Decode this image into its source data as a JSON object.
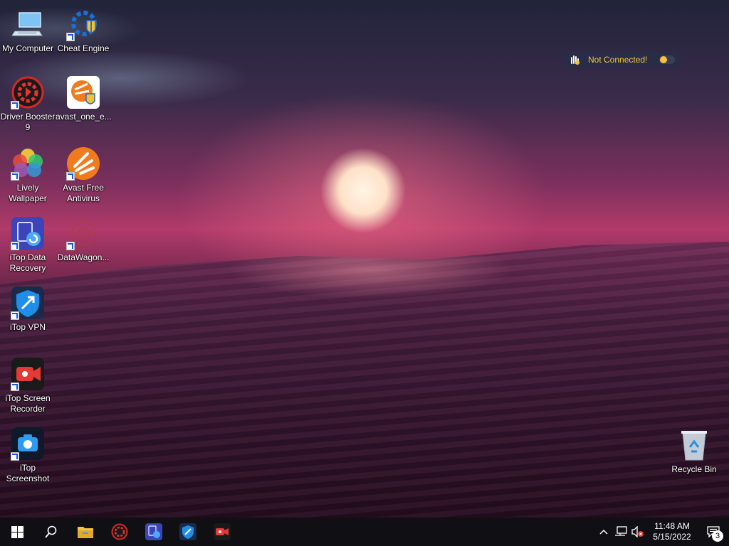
{
  "desktop": {
    "icons": [
      {
        "label": "My Computer",
        "icon": "computer-icon"
      },
      {
        "label": "Cheat Engine",
        "icon": "cheat-engine-icon"
      },
      {
        "label": "Driver Booster 9",
        "icon": "driver-booster-icon"
      },
      {
        "label": "avast_one_e...",
        "icon": "avast-one-installer-icon"
      },
      {
        "label": "Lively Wallpaper",
        "icon": "lively-wallpaper-icon"
      },
      {
        "label": "Avast Free Antivirus",
        "icon": "avast-icon"
      },
      {
        "label": "iTop Data Recovery",
        "icon": "itop-data-recovery-icon"
      },
      {
        "label": "DataWagon...",
        "icon": "datawagon-icon"
      },
      {
        "label": "iTop VPN",
        "icon": "itop-vpn-icon"
      },
      {
        "label": "iTop Screen Recorder",
        "icon": "itop-screen-recorder-icon"
      },
      {
        "label": "iTop Screenshot",
        "icon": "itop-screenshot-icon"
      },
      {
        "label": "Recycle Bin",
        "icon": "recycle-bin-icon"
      }
    ]
  },
  "vpn_widget": {
    "status": "Not Connected!",
    "accent": "#f5c43a"
  },
  "taskbar": {
    "pinned": [
      "start-icon",
      "search-icon",
      "file-explorer-icon",
      "driver-booster-icon",
      "itop-data-recovery-icon",
      "itop-vpn-icon",
      "itop-screen-recorder-icon"
    ],
    "clock_time": "11:48 AM",
    "clock_date": "5/15/2022",
    "notification_count": "3"
  }
}
